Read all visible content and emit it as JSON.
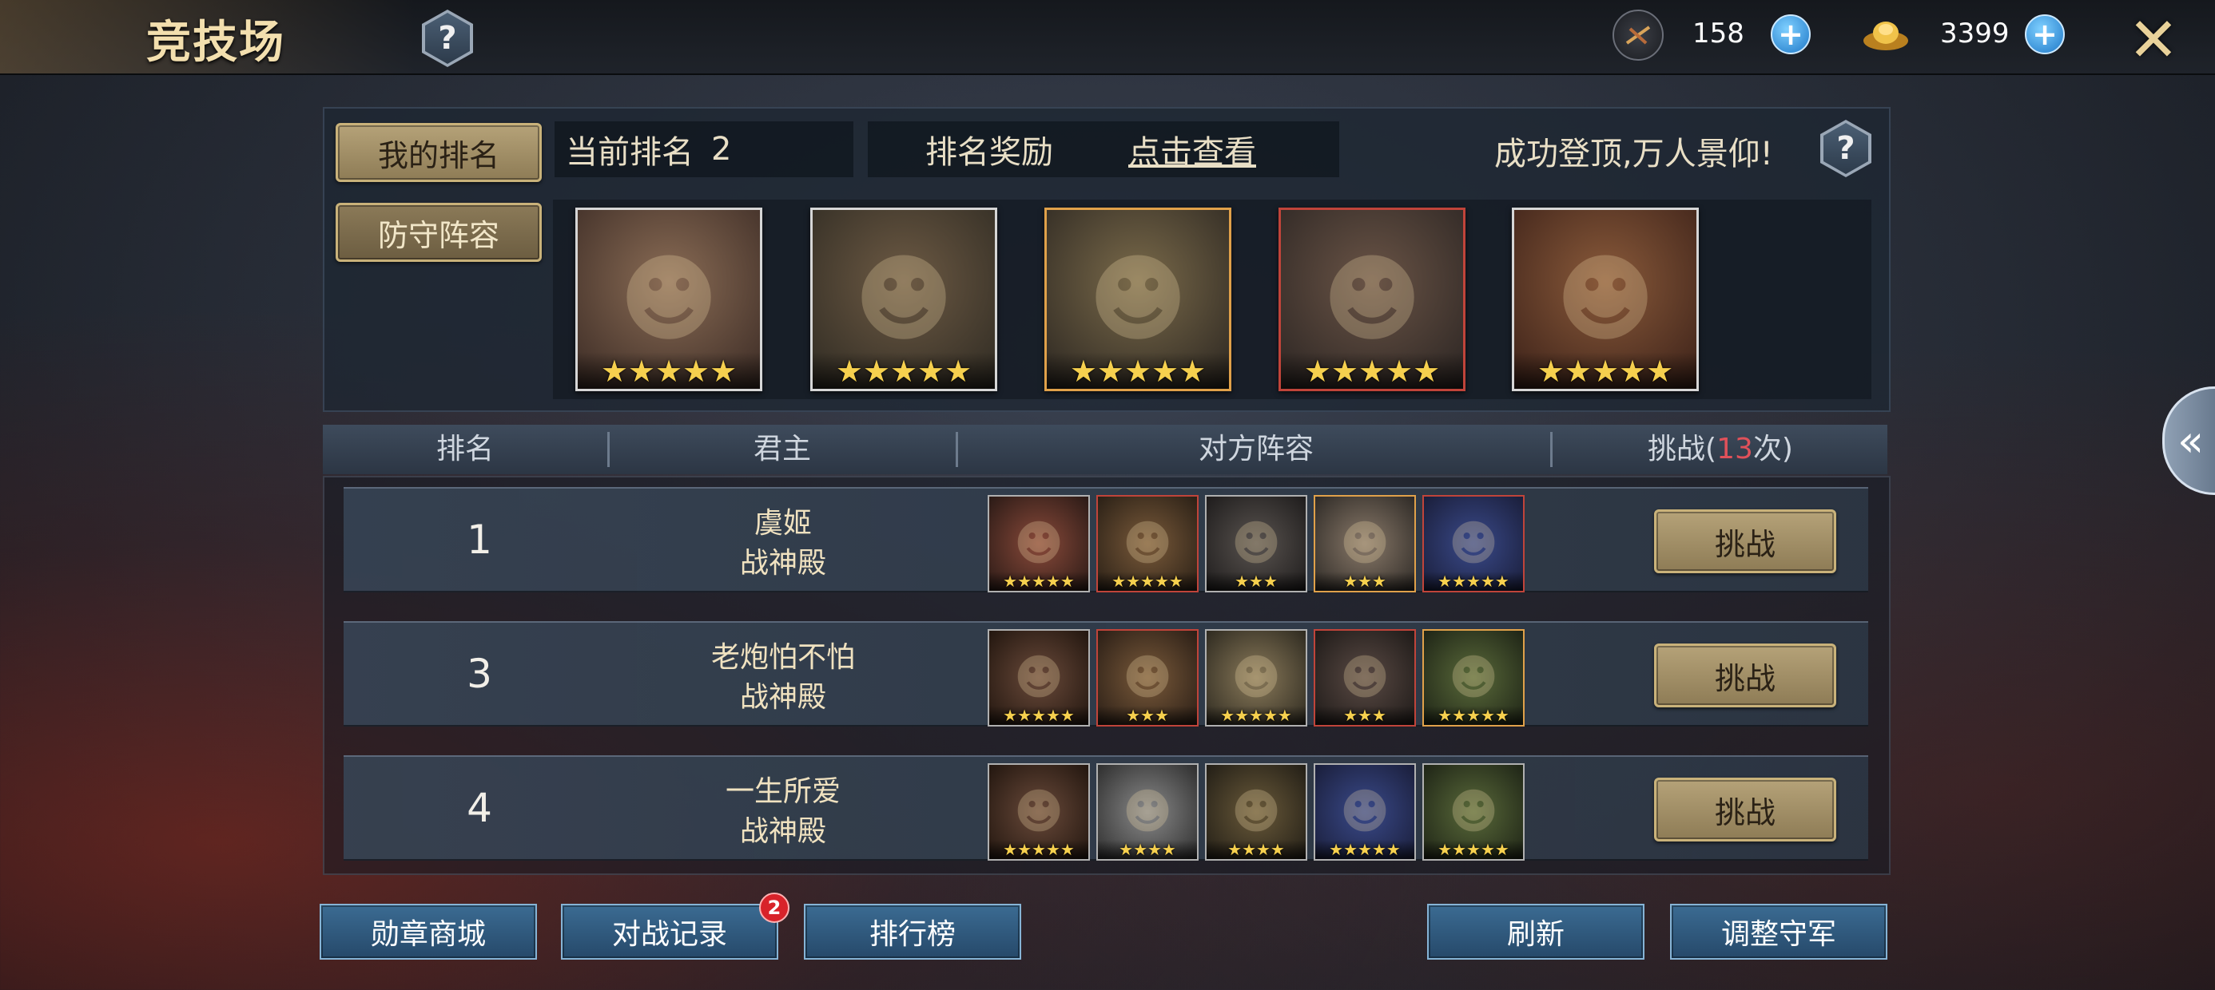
{
  "header": {
    "title": "竞技场",
    "help_icon": "question-icon",
    "resources": [
      {
        "icon": "token-icon",
        "value": "158"
      },
      {
        "icon": "gold-ingot-icon",
        "value": "3399"
      }
    ],
    "close_icon": "close-icon"
  },
  "my_panel": {
    "my_rank_tab": "我的排名",
    "defense_tab": "防守阵容",
    "current_rank_label": "当前排名",
    "current_rank_value": "2",
    "reward_label": "排名奖励",
    "reward_link": "点击查看",
    "slogan": "成功登顶,万人景仰!",
    "defense_heroes": [
      {
        "stars": "★★★★★"
      },
      {
        "stars": "★★★★★"
      },
      {
        "stars": "★★★★★"
      },
      {
        "stars": "★★★★★"
      },
      {
        "stars": "★★★★★"
      }
    ]
  },
  "table": {
    "headers": {
      "rank": "排名",
      "lord": "君主",
      "lineup": "对方阵容",
      "challenge_prefix": "挑战(",
      "challenge_count": "13",
      "challenge_suffix": "次)"
    },
    "rows": [
      {
        "rank": "1",
        "name": "虞姬",
        "server": "战神殿",
        "button": "挑战",
        "heroes": [
          {
            "stars": "★★★★★"
          },
          {
            "stars": "★★★★★"
          },
          {
            "stars": "★★★"
          },
          {
            "stars": "★★★"
          },
          {
            "stars": "★★★★★"
          }
        ]
      },
      {
        "rank": "3",
        "name": "老炮怕不怕",
        "server": "战神殿",
        "button": "挑战",
        "heroes": [
          {
            "stars": "★★★★★"
          },
          {
            "stars": "★★★"
          },
          {
            "stars": "★★★★★"
          },
          {
            "stars": "★★★"
          },
          {
            "stars": "★★★★★"
          }
        ]
      },
      {
        "rank": "4",
        "name": "一生所爱",
        "server": "战神殿",
        "button": "挑战",
        "heroes": [
          {
            "stars": "★★★★★"
          },
          {
            "stars": "★★★★"
          },
          {
            "stars": "★★★★"
          },
          {
            "stars": "★★★★★"
          },
          {
            "stars": "★★★★★"
          }
        ]
      }
    ]
  },
  "footer": {
    "medal_shop": "勋章商城",
    "battle_log": "对战记录",
    "battle_log_badge": "2",
    "leaderboard": "排行榜",
    "refresh": "刷新",
    "adjust_defense": "调整守军"
  },
  "colors": {
    "accent_gold": "#c9b27a",
    "button_blue": "#2f5a80",
    "challenge_count_red": "#e0515a"
  }
}
